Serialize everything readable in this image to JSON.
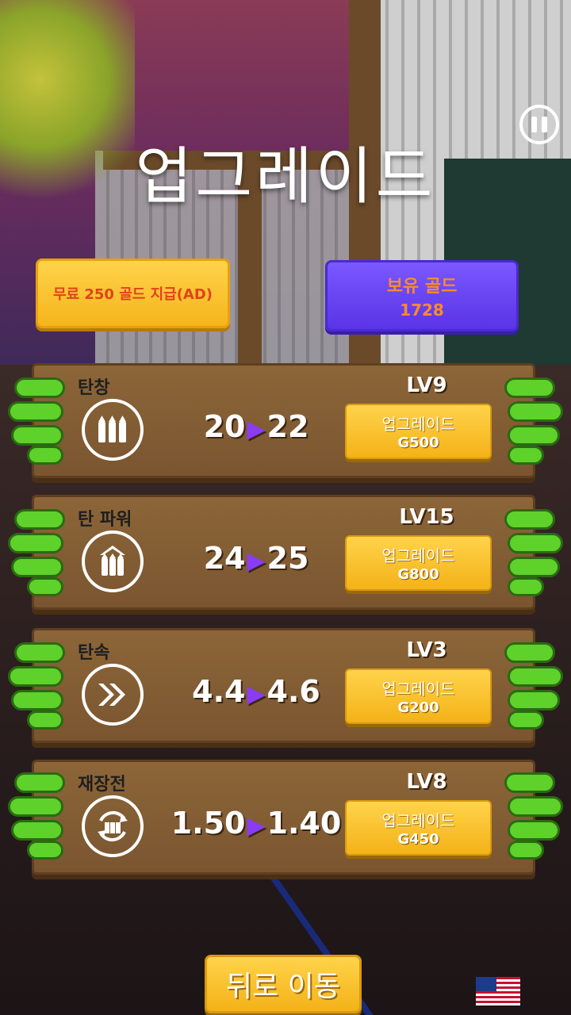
{
  "title": "업그레이드",
  "free_gold_button": "무료 250 골드 지급(AD)",
  "gold": {
    "label": "보유 골드",
    "value": "1728"
  },
  "upgrades": [
    {
      "name": "탄창",
      "current": "20",
      "next": "22",
      "level": "LV9",
      "button_label": "업그레이드",
      "cost": "G500",
      "icon": "bullets-icon"
    },
    {
      "name": "탄 파워",
      "current": "24",
      "next": "25",
      "level": "LV15",
      "button_label": "업그레이드",
      "cost": "G800",
      "icon": "bullet-power-icon"
    },
    {
      "name": "탄속",
      "current": "4.4",
      "next": "4.6",
      "level": "LV3",
      "button_label": "업그레이드",
      "cost": "G200",
      "icon": "fast-forward-icon"
    },
    {
      "name": "재장전",
      "current": "1.50",
      "next": "1.40",
      "level": "LV8",
      "button_label": "업그레이드",
      "cost": "G450",
      "icon": "reload-icon"
    }
  ],
  "arrow_glyph": "▶",
  "back_button": "뒤로 이동",
  "language_flag": "us-flag-icon"
}
